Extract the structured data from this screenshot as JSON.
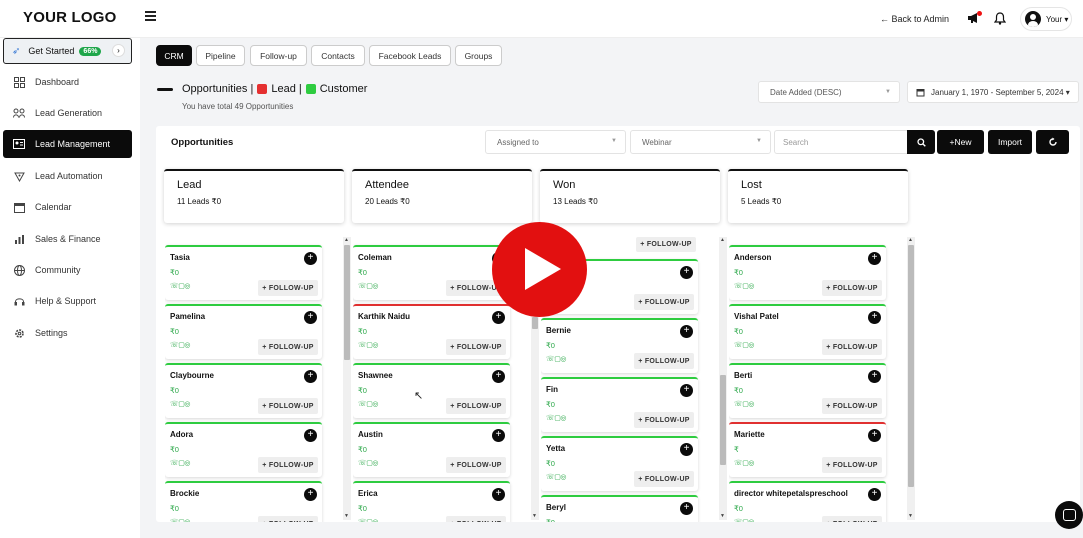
{
  "header": {
    "logo": "YOUR LOGO",
    "back_to_admin": "← Back to Admin",
    "user_name": "Your ▾",
    "icons": [
      "hamburger-icon",
      "megaphone-icon",
      "bell-icon",
      "avatar"
    ],
    "notification_color": "#e11111"
  },
  "sidebar": {
    "get_started": {
      "label": "Get Started",
      "progress": "66%",
      "progress_value": 0.66
    },
    "items": [
      {
        "label": "Dashboard",
        "icon": "dashboard-icon",
        "active": false
      },
      {
        "label": "Lead Generation",
        "icon": "users-icon",
        "active": false
      },
      {
        "label": "Lead Management",
        "icon": "id-card-icon",
        "active": true
      },
      {
        "label": "Lead Automation",
        "icon": "automation-icon",
        "active": false
      },
      {
        "label": "Calendar",
        "icon": "calendar-icon",
        "active": false
      },
      {
        "label": "Sales & Finance",
        "icon": "bar-chart-icon",
        "active": false
      },
      {
        "label": "Community",
        "icon": "globe-icon",
        "active": false
      },
      {
        "label": "Help & Support",
        "icon": "headset-icon",
        "active": false
      },
      {
        "label": "Settings",
        "icon": "gear-icon",
        "active": false
      }
    ]
  },
  "tabs": [
    {
      "label": "CRM",
      "active": true
    },
    {
      "label": "Pipeline",
      "active": false
    },
    {
      "label": "Follow-up",
      "active": false
    },
    {
      "label": "Contacts",
      "active": false
    },
    {
      "label": "Facebook Leads",
      "active": false
    },
    {
      "label": "Groups",
      "active": false
    }
  ],
  "heading": {
    "opportunities": "Opportunities |",
    "lead": "Lead |",
    "customer": "Customer",
    "lead_color": "#e53030",
    "customer_color": "#2ecc40",
    "subtitle": "You have total 49 Opportunities"
  },
  "filters": {
    "sort": "Date Added (DESC)",
    "date_range": "January 1, 1970 - September 5, 2024 ▾"
  },
  "panel": {
    "title": "Opportunities",
    "assigned_to": "Assigned to",
    "webinar": "Webinar",
    "search_placeholder": "Search",
    "new_label": "+New",
    "import_label": "Import"
  },
  "columns": [
    {
      "title": "Lead",
      "summary": "11 Leads ₹0"
    },
    {
      "title": "Attendee",
      "summary": "20 Leads ₹0"
    },
    {
      "title": "Won",
      "summary": "13 Leads ₹0"
    },
    {
      "title": "Lost",
      "summary": "5 Leads ₹0"
    }
  ],
  "card_icons": "☏▢◎",
  "follow_up_label": "+ FOLLOW-UP",
  "cards": {
    "lead": [
      {
        "name": "Tasia",
        "amount": "₹0",
        "status": "green"
      },
      {
        "name": "Pamelina",
        "amount": "₹0",
        "status": "green"
      },
      {
        "name": "Claybourne",
        "amount": "₹0",
        "status": "green"
      },
      {
        "name": "Adora",
        "amount": "₹0",
        "status": "green"
      },
      {
        "name": "Brockie",
        "amount": "₹0",
        "status": "green"
      }
    ],
    "attendee": [
      {
        "name": "Coleman",
        "amount": "₹0",
        "status": "green"
      },
      {
        "name": "Karthik Naidu",
        "amount": "₹0",
        "status": "red"
      },
      {
        "name": "Shawnee",
        "amount": "₹0",
        "status": "green"
      },
      {
        "name": "Austin",
        "amount": "₹0",
        "status": "green"
      },
      {
        "name": "Erica",
        "amount": "₹0",
        "status": "green"
      }
    ],
    "won": [
      {
        "name": "",
        "amount": "",
        "status": "green"
      },
      {
        "name": "Bernie",
        "amount": "₹0",
        "status": "green"
      },
      {
        "name": "Fin",
        "amount": "₹0",
        "status": "green"
      },
      {
        "name": "Yetta",
        "amount": "₹0",
        "status": "green"
      },
      {
        "name": "Beryl",
        "amount": "₹0",
        "status": "green"
      }
    ],
    "lost": [
      {
        "name": "Anderson",
        "amount": "₹0",
        "status": "green"
      },
      {
        "name": "Vishal Patel",
        "amount": "₹0",
        "status": "green"
      },
      {
        "name": "Berti",
        "amount": "₹0",
        "status": "green"
      },
      {
        "name": "Mariette",
        "amount": "₹",
        "status": "red"
      },
      {
        "name": "director whitepetalspreschool",
        "amount": "₹0",
        "status": "green"
      }
    ]
  }
}
